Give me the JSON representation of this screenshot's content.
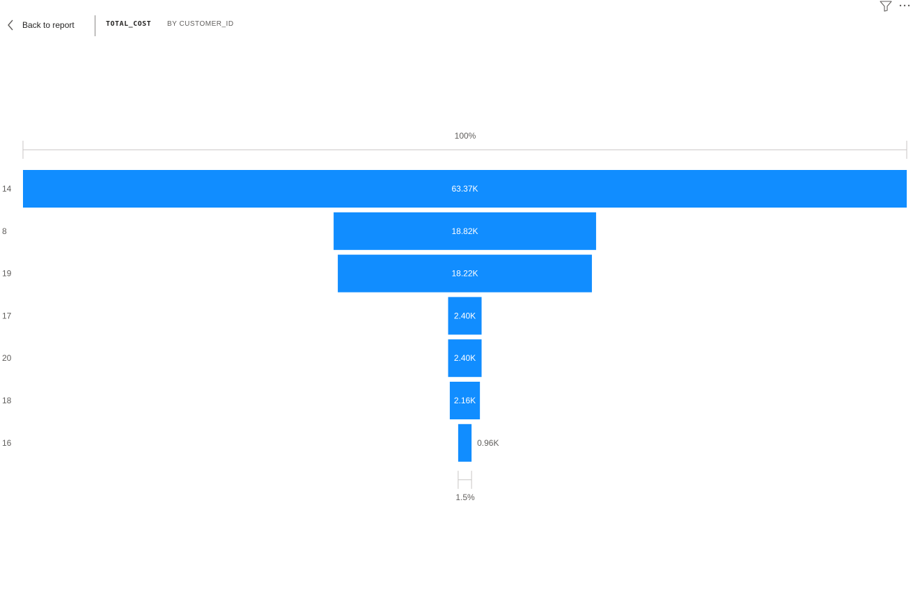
{
  "toolbar": {
    "back_label": "Back to report",
    "visual_title": "TOTAL_COST",
    "visual_subtitle": "BY CUSTOMER_ID",
    "icons": [
      "chevron-left-icon",
      "filter-icon",
      "more-options-icon"
    ]
  },
  "chart_data": {
    "type": "funnel",
    "categories": [
      "14",
      "8",
      "19",
      "17",
      "20",
      "18",
      "16"
    ],
    "values": [
      63370,
      18820,
      18220,
      2400,
      2400,
      2160,
      960
    ],
    "labels": [
      "63.37K",
      "18.82K",
      "18.22K",
      "2.40K",
      "2.40K",
      "2.16K",
      "0.96K"
    ],
    "top_percent_label": "100%",
    "bottom_percent_label": "1.5%",
    "bar_color": "#118dff",
    "label_color_inside": "#ffffff",
    "label_color_outside": "#605e5c"
  }
}
